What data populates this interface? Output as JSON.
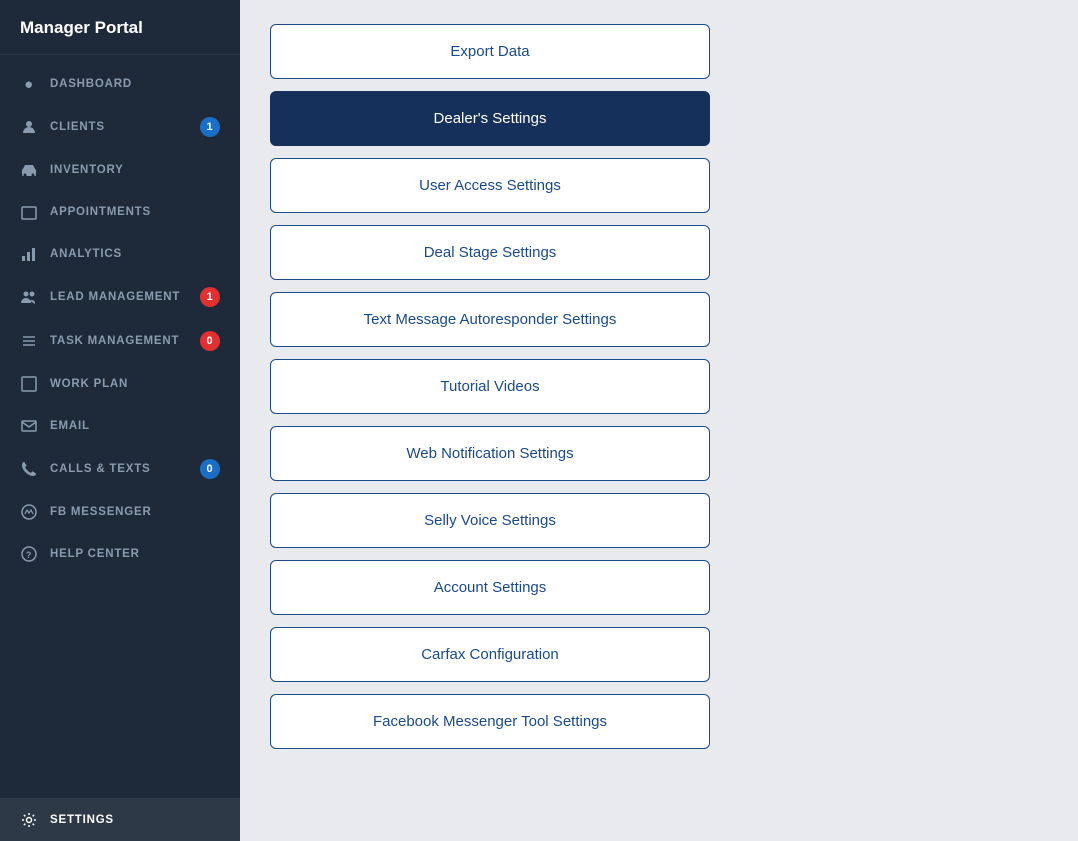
{
  "sidebar": {
    "logo": "Manager Portal",
    "nav_items": [
      {
        "id": "dashboard",
        "label": "DASHBOARD",
        "icon": "👤",
        "badge": null
      },
      {
        "id": "clients",
        "label": "CLIENTS",
        "icon": "👤",
        "badge": "1",
        "badge_type": "blue"
      },
      {
        "id": "inventory",
        "label": "INVENTORY",
        "icon": "🚗",
        "badge": null
      },
      {
        "id": "appointments",
        "label": "APPOINTMENTS",
        "icon": "📅",
        "badge": null
      },
      {
        "id": "analytics",
        "label": "ANALYTICS",
        "icon": "📊",
        "badge": null
      },
      {
        "id": "lead-management",
        "label": "LEAD MANAGEMENT",
        "icon": "👥",
        "badge": "1",
        "badge_type": "red"
      },
      {
        "id": "task-management",
        "label": "TASK MANAGEMENT",
        "icon": "☰",
        "badge": "0",
        "badge_type": "red"
      },
      {
        "id": "work-plan",
        "label": "WORK PLAN",
        "icon": "🗂",
        "badge": null
      },
      {
        "id": "email",
        "label": "EMAIL",
        "icon": "✉",
        "badge": null
      },
      {
        "id": "calls-texts",
        "label": "CALLS & TEXTS",
        "icon": "📞",
        "badge": "0",
        "badge_type": "blue"
      },
      {
        "id": "fb-messenger",
        "label": "FB MESSENGER",
        "icon": "💬",
        "badge": null
      },
      {
        "id": "help-center",
        "label": "HELP CENTER",
        "icon": "?",
        "badge": null
      }
    ],
    "bottom_item": {
      "id": "settings",
      "label": "SETTINGS",
      "icon": "⚙",
      "active": true
    }
  },
  "main": {
    "buttons": [
      {
        "id": "export-data",
        "label": "Export Data",
        "active": false
      },
      {
        "id": "dealers-settings",
        "label": "Dealer's Settings",
        "active": true
      },
      {
        "id": "user-access-settings",
        "label": "User Access Settings",
        "active": false
      },
      {
        "id": "deal-stage-settings",
        "label": "Deal Stage Settings",
        "active": false
      },
      {
        "id": "text-message-autoresponder",
        "label": "Text Message Autoresponder Settings",
        "active": false
      },
      {
        "id": "tutorial-videos",
        "label": "Tutorial Videos",
        "active": false
      },
      {
        "id": "web-notification-settings",
        "label": "Web Notification Settings",
        "active": false
      },
      {
        "id": "selly-voice-settings",
        "label": "Selly Voice Settings",
        "active": false
      },
      {
        "id": "account-settings",
        "label": "Account Settings",
        "active": false
      },
      {
        "id": "carfax-configuration",
        "label": "Carfax Configuration",
        "active": false
      },
      {
        "id": "facebook-messenger-tool",
        "label": "Facebook Messenger Tool Settings",
        "active": false
      }
    ]
  },
  "colors": {
    "sidebar_bg": "#1e2a3a",
    "active_btn_bg": "#16305c",
    "btn_border": "#1a4a8a",
    "btn_text": "#1a4a8a"
  }
}
